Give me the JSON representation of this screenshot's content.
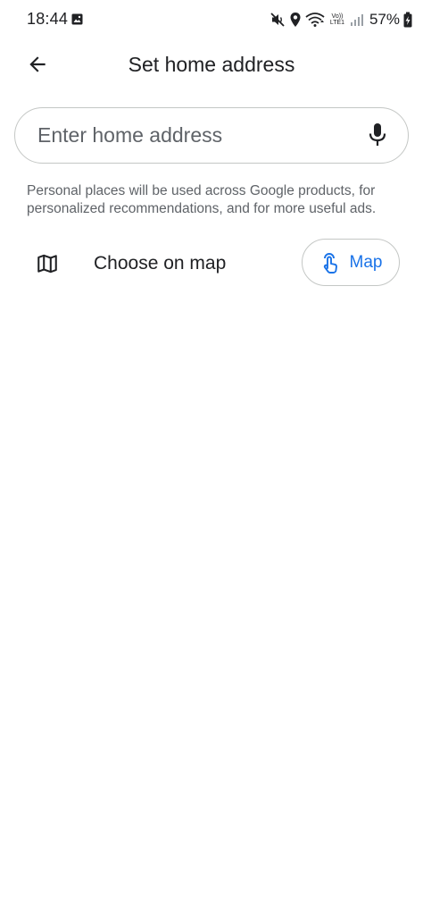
{
  "status_bar": {
    "time": "18:44",
    "network_label_top": "Vo))",
    "network_label_bottom": "LTE1",
    "battery": "57%"
  },
  "app_bar": {
    "title": "Set home address",
    "back_icon": "arrow-back-icon"
  },
  "search": {
    "placeholder": "Enter home address",
    "value": "",
    "mic_icon": "mic-icon"
  },
  "disclaimer": "Personal places will be used across Google products, for personalized recommendations, and for more useful ads.",
  "choose_on_map": {
    "label": "Choose on map",
    "icon": "map-icon",
    "button_label": "Map",
    "button_icon": "touch-icon"
  },
  "colors": {
    "accent": "#1a73e8",
    "text_primary": "#202124",
    "text_secondary": "#5f6368",
    "border": "#c4c7c5"
  }
}
